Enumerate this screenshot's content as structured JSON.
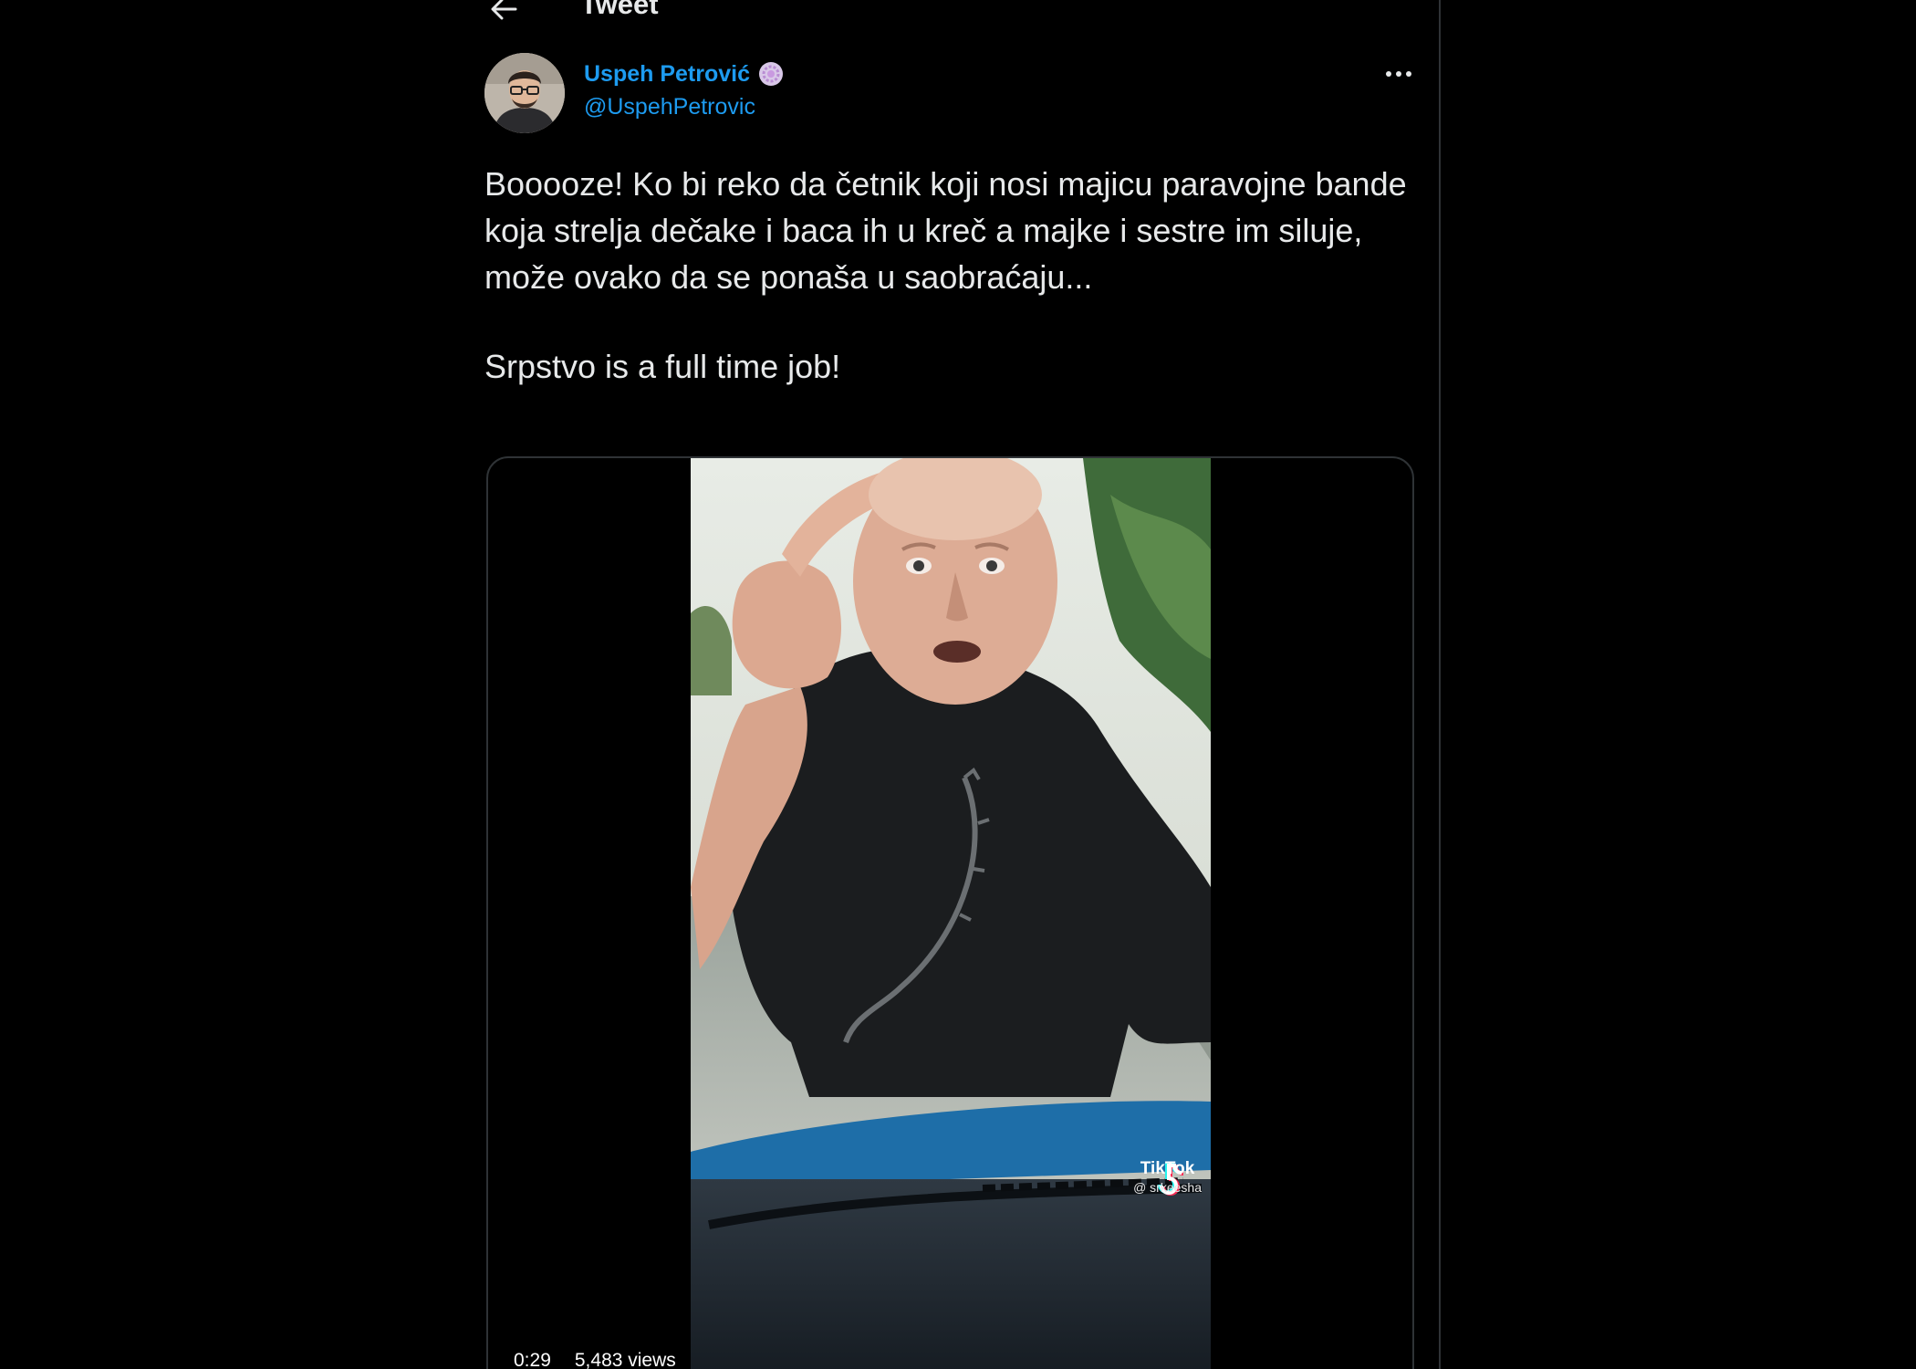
{
  "header": {
    "back_icon": "arrow-left-icon",
    "title": "Tweet"
  },
  "author": {
    "display_name": "Uspeh Petrović",
    "username": "@UspehPetrovic",
    "badge_icon": "flower-badge-icon",
    "name_color": "#1d9bf0"
  },
  "tweet": {
    "paragraphs": [
      "Booooze! Ko bi reko da četnik koji nosi majicu paravojne bande koja strelja dečake i baca ih u kreč a majke i sestre im siluje, može ovako da se ponaša u saobraćaju...",
      "Srpstvo is a full time job!"
    ]
  },
  "more_icon": "more-horizontal-icon",
  "video": {
    "duration": "0:29",
    "views": "5,483 views",
    "watermark_brand": "TikTok",
    "watermark_handle": "@ srkeesha"
  },
  "colors": {
    "background": "#000000",
    "text": "#e7e9ea",
    "accent": "#1d9bf0",
    "border": "#2f3336"
  }
}
